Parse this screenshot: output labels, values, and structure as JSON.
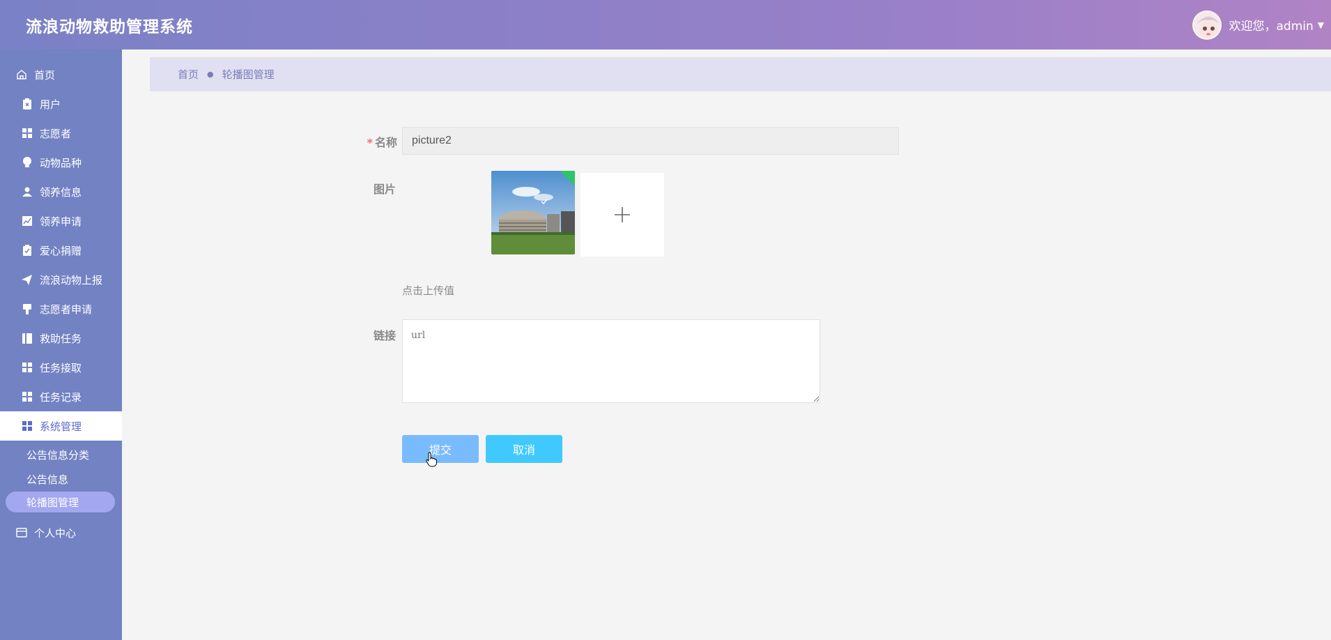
{
  "header": {
    "title": "流浪动物救助管理系统",
    "welcome": "欢迎您，admin",
    "avatar_icon": "avatar-image",
    "gradient": [
      "#7a81c6",
      "#b083c5"
    ]
  },
  "sidebar": {
    "home": "首页",
    "items": [
      {
        "label": "用户",
        "icon": "clipboard-x-icon"
      },
      {
        "label": "志愿者",
        "icon": "grid-icon"
      },
      {
        "label": "动物品种",
        "icon": "bulb-icon"
      },
      {
        "label": "领养信息",
        "icon": "person-icon"
      },
      {
        "label": "领养申请",
        "icon": "chart-icon"
      },
      {
        "label": "爱心捐赠",
        "icon": "clipboard-check-icon"
      },
      {
        "label": "流浪动物上报",
        "icon": "send-icon"
      },
      {
        "label": "志愿者申请",
        "icon": "stamp-icon"
      },
      {
        "label": "救助任务",
        "icon": "book-icon"
      },
      {
        "label": "任务接取",
        "icon": "grid-icon"
      },
      {
        "label": "任务记录",
        "icon": "grid-icon"
      },
      {
        "label": "系统管理",
        "icon": "grid-icon",
        "active": true
      }
    ],
    "sub_items": [
      {
        "label": "公告信息分类"
      },
      {
        "label": "公告信息"
      },
      {
        "label": "轮播图管理",
        "active": true
      }
    ],
    "personal": "个人中心",
    "accent": "#7282c3"
  },
  "breadcrumb": {
    "home": "首页",
    "current": "轮播图管理"
  },
  "form": {
    "name_label": "名称",
    "name_value": "picture2",
    "image_label": "图片",
    "upload_hint": "点击上传值",
    "link_label": "链接",
    "link_placeholder": "url",
    "submit_label": "提交",
    "cancel_label": "取消"
  }
}
